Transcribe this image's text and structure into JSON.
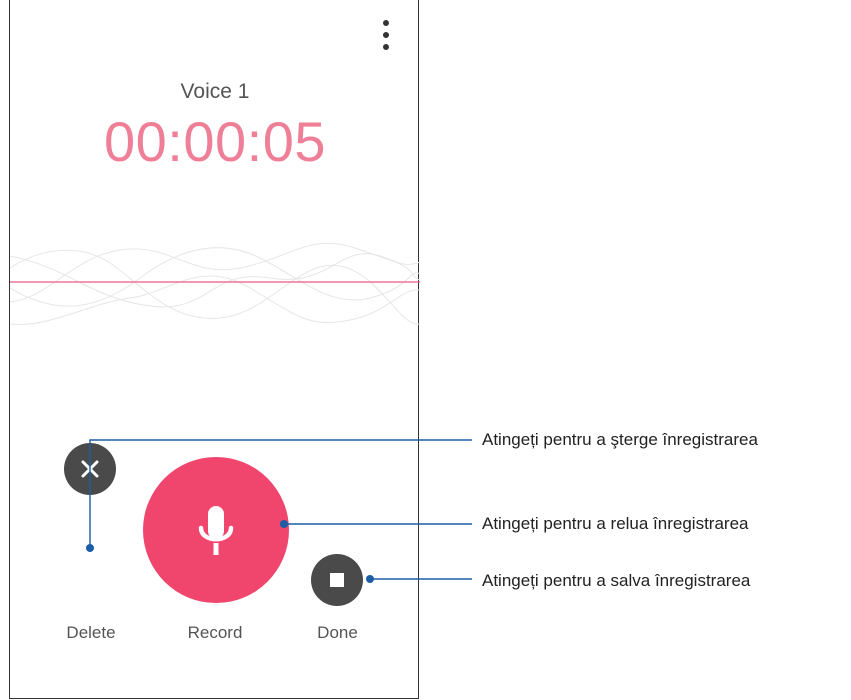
{
  "recorder": {
    "recording_name": "Voice 1",
    "elapsed_time": "00:00:05",
    "more_menu_icon": "more-vert-icon",
    "accent_color": "#f0466d",
    "timer_color": "#ee7f97"
  },
  "controls": {
    "delete_label": "Delete",
    "record_label": "Record",
    "done_label": "Done",
    "delete_icon": "close-icon",
    "record_icon": "microphone-icon",
    "done_icon": "stop-icon"
  },
  "annotations": [
    {
      "target": "delete",
      "text": "Atingeți pentru a şterge înregistrarea"
    },
    {
      "target": "record",
      "text": "Atingeți pentru a relua înregistrarea"
    },
    {
      "target": "done",
      "text": "Atingeți pentru a salva înregistrarea"
    }
  ]
}
